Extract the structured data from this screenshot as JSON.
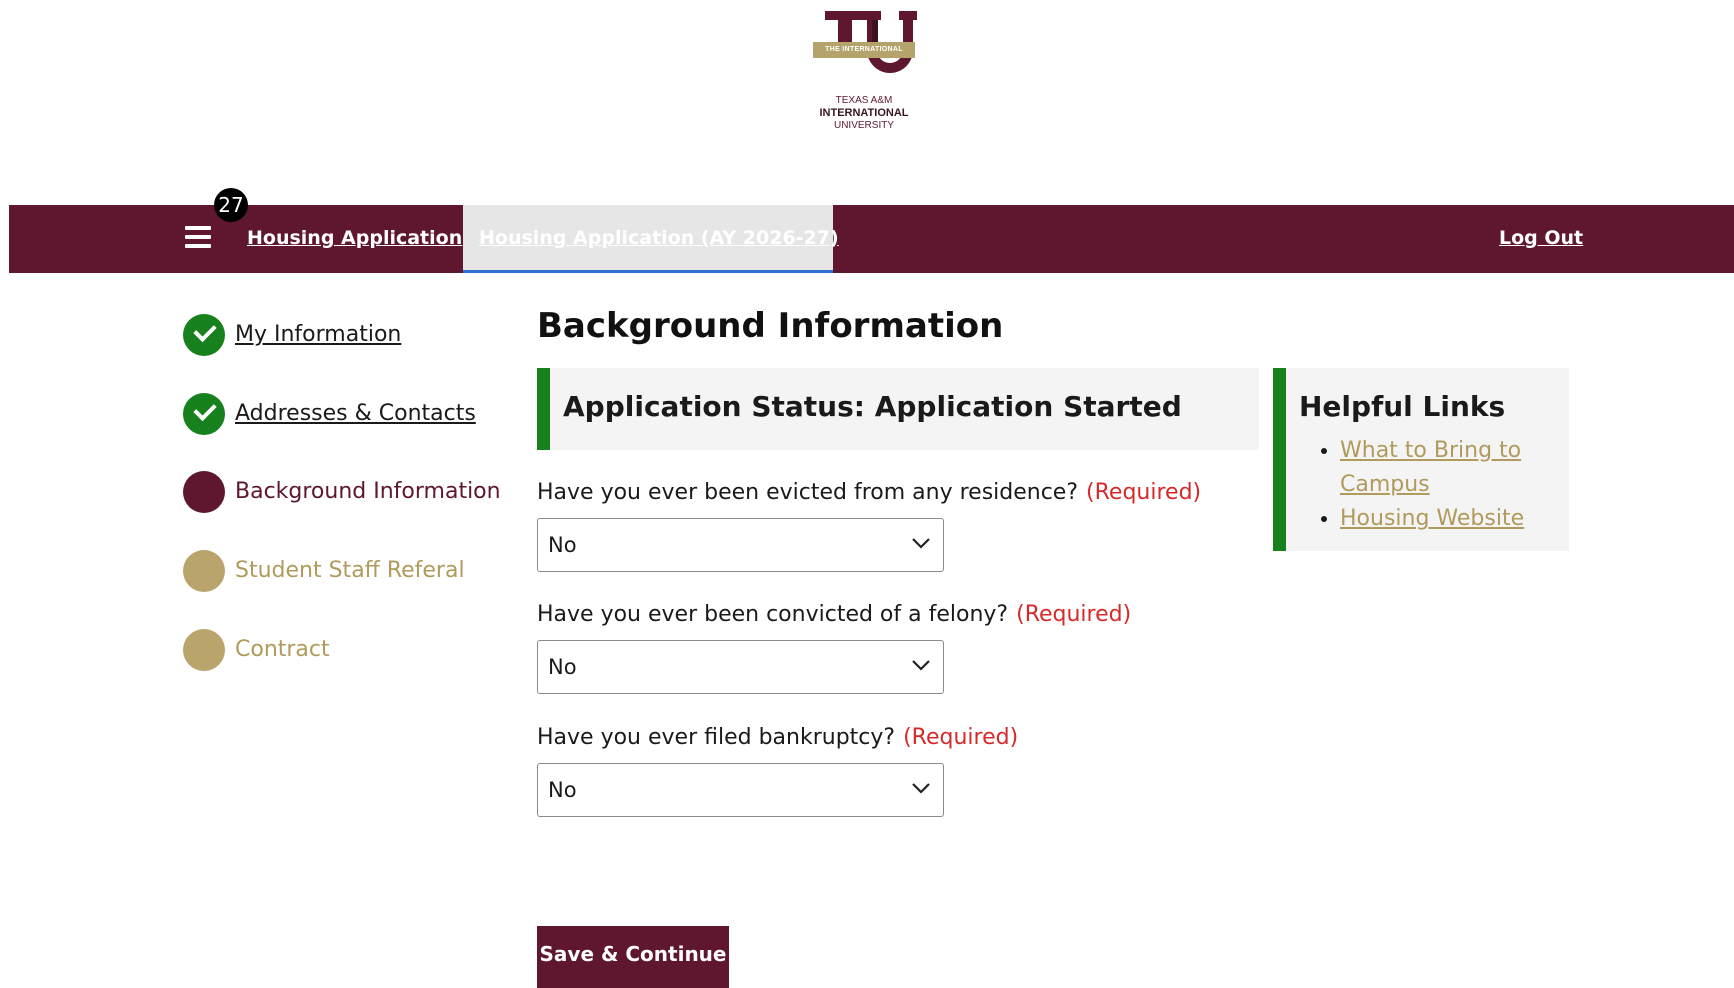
{
  "logo": {
    "ribbon": "THE INTERNATIONAL",
    "line1": "TEXAS A&M",
    "line2": "INTERNATIONAL",
    "line3": "UNIVERSITY"
  },
  "nav": {
    "badge_count": "27",
    "home_label": "Housing Application",
    "active_tab_label": "Housing Application (AY 2026-27)",
    "logout_label": "Log Out"
  },
  "steps": [
    {
      "label": "My Information",
      "state": "done"
    },
    {
      "label": "Addresses & Contacts",
      "state": "done"
    },
    {
      "label": "Background Information",
      "state": "current"
    },
    {
      "label": "Student Staff Referal",
      "state": "todo"
    },
    {
      "label": "Contract",
      "state": "todo"
    }
  ],
  "main": {
    "title": "Background Information",
    "status": "Application Status: Application Started",
    "required_text": "(Required)",
    "questions": [
      {
        "label": "Have you ever been evicted from any residence?",
        "value": "No"
      },
      {
        "label": "Have you ever been convicted of a felony?",
        "value": "No"
      },
      {
        "label": "Have you ever filed bankruptcy?",
        "value": "No"
      }
    ],
    "save_label": "Save & Continue"
  },
  "helpful_links": {
    "title": "Helpful Links",
    "items": [
      "What to Bring to Campus",
      "Housing Website"
    ]
  },
  "colors": {
    "maroon": "#5f172f",
    "gold": "#b9a46b",
    "green": "#17821d",
    "required_red": "#d62a2a",
    "tab_underline": "#2f6fd6"
  },
  "icons": {
    "menu": "hamburger-menu-icon",
    "done": "check-circle-icon",
    "dropdown": "chevron-down-icon"
  }
}
